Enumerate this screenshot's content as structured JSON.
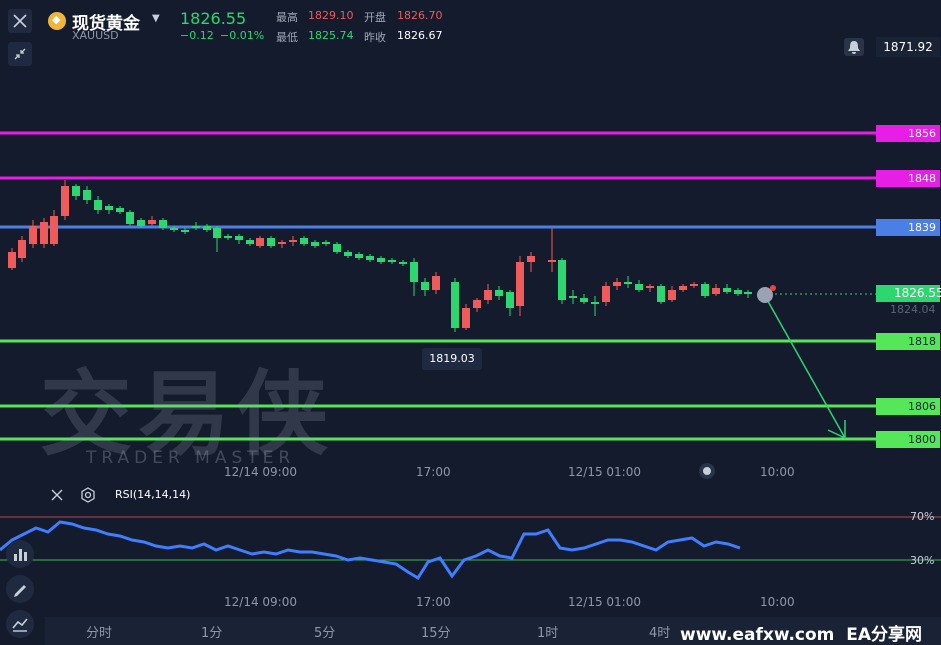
{
  "header": {
    "title": "现货黄金",
    "symbol": "XAUUSD",
    "price": "1826.55",
    "change": "−0.12",
    "change_pct": "−0.01%",
    "high_label": "最高",
    "high_value": "1829.10",
    "open_label": "开盘",
    "open_value": "1826.70",
    "low_label": "最低",
    "low_value": "1825.74",
    "prev_close_label": "昨收",
    "prev_close_value": "1826.67"
  },
  "alert": {
    "value": "1871.92"
  },
  "price_tags": {
    "l1856": "1856",
    "l1848": "1848",
    "l1839": "1839",
    "l1818": "1818",
    "l1806": "1806",
    "l1800": "1800",
    "current": "1826.55",
    "bid": "1824.04"
  },
  "annotation": {
    "low_point": "1819.03"
  },
  "watermark": {
    "cn": "交易侠",
    "en": "TRADER MASTER"
  },
  "x_axis": [
    "12/14 09:00",
    "17:00",
    "12/15 01:00",
    "10:00"
  ],
  "rsi": {
    "label": "RSI(14,14,14)",
    "upper": "70%",
    "lower": "30%"
  },
  "tabs": [
    "分时",
    "1分",
    "5分",
    "15分",
    "1时",
    "4时"
  ],
  "footer": {
    "url": "www.eafxw.com",
    "brand": "EA分享网"
  },
  "colors": {
    "bg": "#141b2c",
    "up": "#ef5a5a",
    "down": "#2ed66f",
    "magenta": "#e61ee6",
    "blue": "#4a7fe6",
    "green_line": "#55e65a"
  }
}
